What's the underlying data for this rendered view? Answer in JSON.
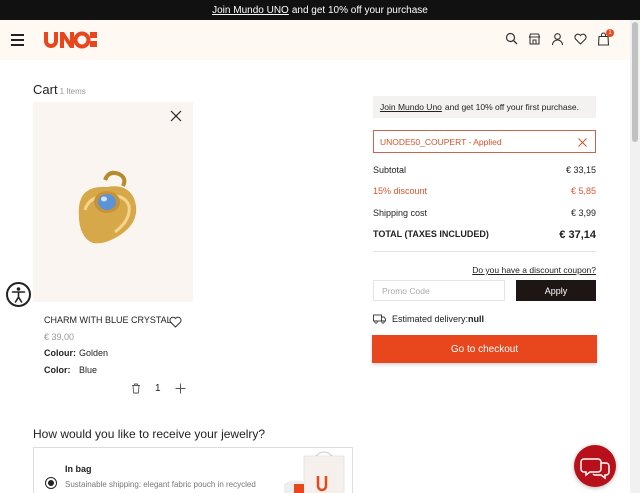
{
  "topbar": {
    "link": "Join Mundo UNO",
    "text": "and get 10% off your purchase"
  },
  "header": {
    "cart_count": "1"
  },
  "cart": {
    "title": "Cart",
    "count_label": "1 Items"
  },
  "product": {
    "name": "CHARM WITH BLUE CRYSTAL",
    "price": "€ 39,00",
    "colour_label": "Colour:",
    "colour_value": "Golden",
    "color_label": "Color:",
    "color_value": "Blue",
    "quantity": "1"
  },
  "receive": {
    "title": "How would you like to receive your jewelry?",
    "option_title": "In bag",
    "option_desc": "Sustainable shipping: elegant fabric pouch in recycled"
  },
  "summary": {
    "join_link": "Join Mundo Uno",
    "join_text": "and get 10% off your first purchase.",
    "coupon_applied": "UNODE50_COUPERT - Applied",
    "subtotal_label": "Subtotal",
    "subtotal_value": "€ 33,15",
    "discount_label": "15% discount",
    "discount_value": "€ 5,85",
    "shipping_label": "Shipping cost",
    "shipping_value": "€ 3,99",
    "total_label": "TOTAL (TAXES INCLUDED)",
    "total_value": "€ 37,14",
    "discount_link": "Do you have a discount coupon?",
    "promo_placeholder": "Promo Code",
    "apply_label": "Apply",
    "delivery_label": "Estimated delivery:",
    "delivery_value": "null",
    "checkout_label": "Go to checkout"
  },
  "colors": {
    "accent": "#e8471d",
    "dark": "#1e1614",
    "header_bg": "#fff8f3"
  }
}
